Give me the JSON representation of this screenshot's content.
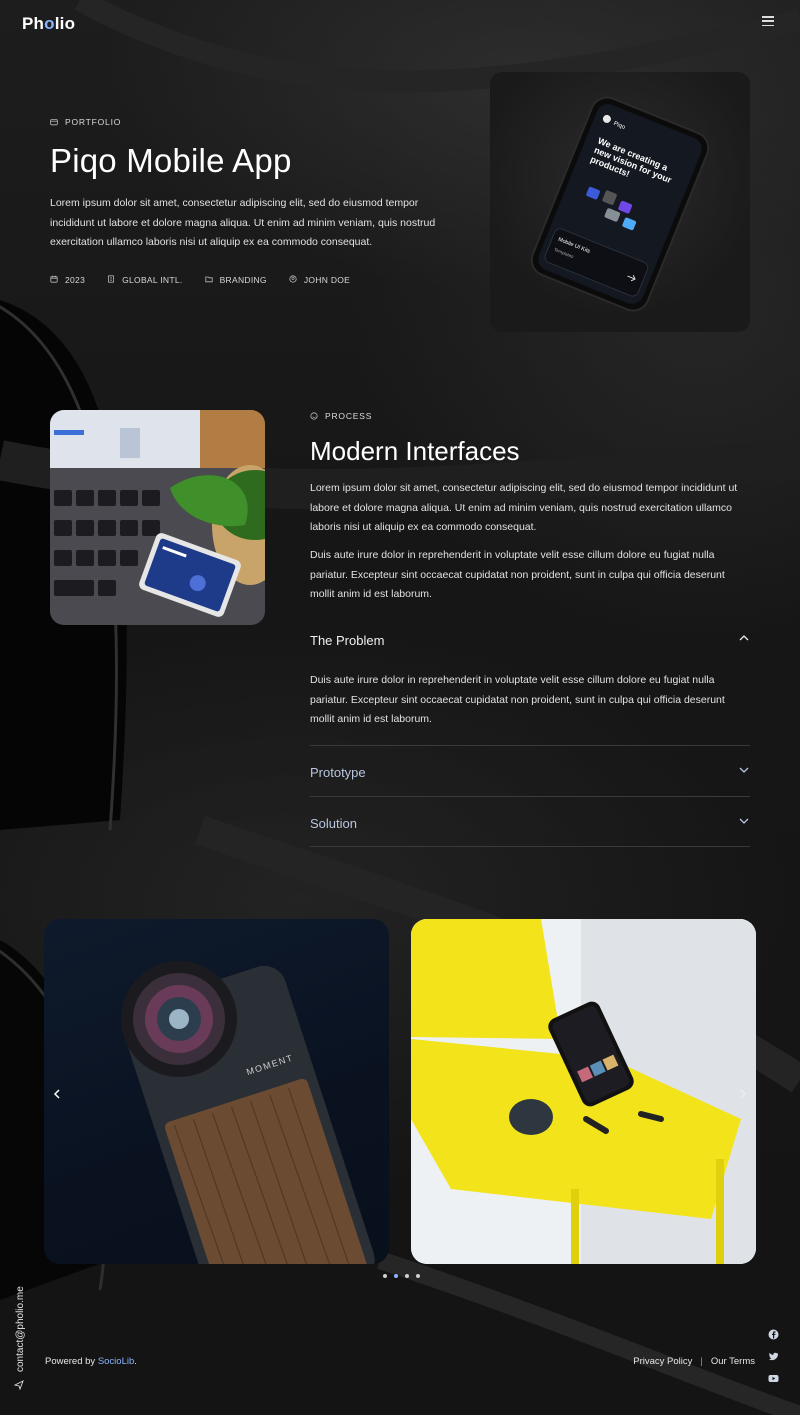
{
  "brand": {
    "logo_prefix": "Ph",
    "logo_dot": "o",
    "logo_suffix": "lio"
  },
  "hero": {
    "kicker": "PORTFOLIO",
    "title": "Piqo Mobile App",
    "description": "Lorem ipsum dolor sit amet, consectetur adipiscing elit, sed do eiusmod tempor incididunt ut labore et dolore magna aliqua. Ut enim ad minim veniam, quis nostrud exercitation ullamco laboris nisi ut aliquip ex ea commodo consequat.",
    "meta": {
      "year": "2023",
      "client": "GLOBAL INTL.",
      "category": "BRANDING",
      "author": "JOHN DOE"
    },
    "phone_screen": {
      "brand": "Piqo",
      "headline": "We are creating a new vision for your products!",
      "card_title": "Mobile UI Kits",
      "card_sub": "Templates"
    }
  },
  "process": {
    "kicker": "PROCESS",
    "title": "Modern Interfaces",
    "paragraph1": "Lorem ipsum dolor sit amet, consectetur adipiscing elit, sed do eiusmod tempor incididunt ut labore et dolore magna aliqua. Ut enim ad minim veniam, quis nostrud exercitation ullamco laboris nisi ut aliquip ex ea commodo consequat.",
    "paragraph2": "Duis aute irure dolor in reprehenderit in voluptate velit esse cillum dolore eu fugiat nulla pariatur. Excepteur sint occaecat cupidatat non proident, sunt in culpa qui officia deserunt mollit anim id est laborum.",
    "accordion": [
      {
        "label": "The Problem",
        "open": true,
        "body": "Duis aute irure dolor in reprehenderit in voluptate velit esse cillum dolore eu fugiat nulla pariatur. Excepteur sint occaecat cupidatat non proident, sunt in culpa qui officia deserunt mollit anim id est laborum."
      },
      {
        "label": "Prototype",
        "open": false
      },
      {
        "label": "Solution",
        "open": false
      }
    ]
  },
  "gallery": {
    "camera_brand": "MOMENT",
    "slide_count": 4,
    "active_slide": 2
  },
  "footer": {
    "contact": "contact@pholio.me",
    "powered_prefix": "Powered by ",
    "powered_link": "SocioLib",
    "powered_suffix": ".",
    "privacy": "Privacy Policy",
    "separator": "|",
    "terms": "Our Terms",
    "social": [
      "facebook-icon",
      "twitter-icon",
      "youtube-icon"
    ]
  },
  "colors": {
    "accent": "#8ab4ff",
    "background": "#121212",
    "chair": "#f2e31b"
  }
}
